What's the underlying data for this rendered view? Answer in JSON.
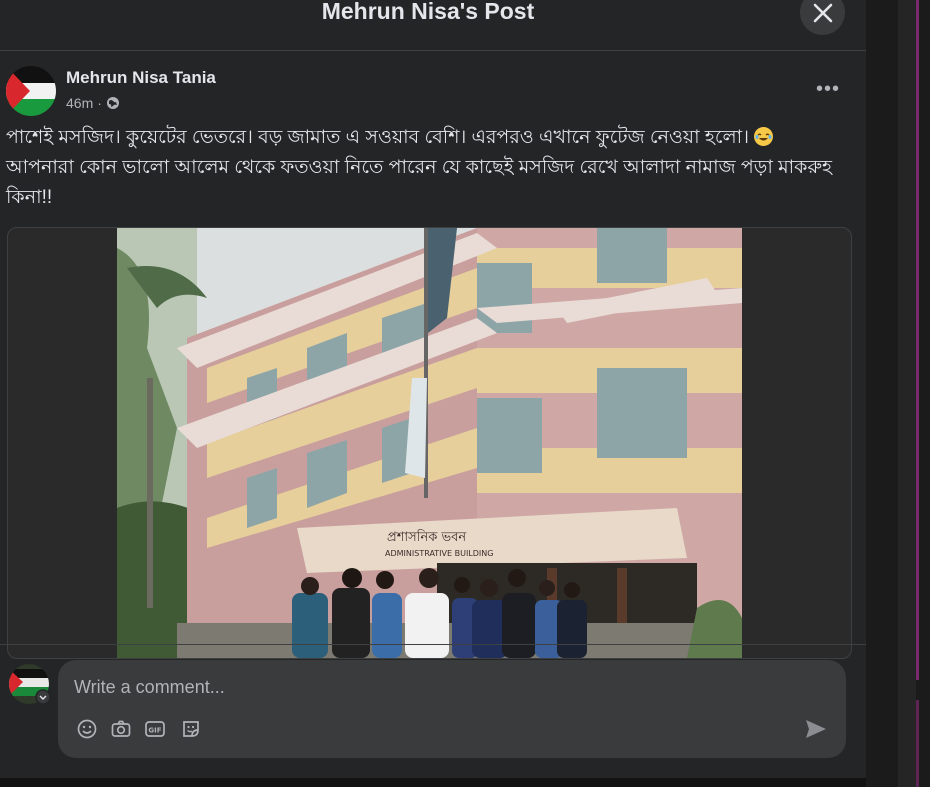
{
  "modal": {
    "title": "Mehrun Nisa's Post",
    "close_icon": "close-icon"
  },
  "post": {
    "author": "Mehrun Nisa Tania",
    "time": "46m",
    "audience_icon": "globe-icon",
    "more_icon": "more-horizontal-icon",
    "text_line1": "পাশেই মসজিদ।  কুয়েটের ভেতরে। বড় জামাত এ সওয়াব বেশি। এরপরও এখানে ফুটেজ নেওয়া হলো।",
    "text_line1_emoji": "rolling-laughing-emoji",
    "text_line2": "আপনারা কোন ভালো আলেম থেকে ফতওয়া নিতে পারেন যে কাছেই মসজিদ রেখে আলাদা নামাজ পড়া মাকরুহ কিনা!!",
    "photo": {
      "sign_bangla": "প্রশাসনিক ভবন",
      "sign_english": "ADMINISTRATIVE BUILDING"
    }
  },
  "comment": {
    "placeholder": "Write a comment...",
    "icons": [
      "emoji-icon",
      "camera-icon",
      "gif-icon",
      "sticker-icon"
    ],
    "send_icon": "send-icon"
  },
  "colors": {
    "background": "#242526",
    "text_primary": "#e4e6eb",
    "text_secondary": "#b0b3b8",
    "input_bg": "#3a3b3c"
  }
}
